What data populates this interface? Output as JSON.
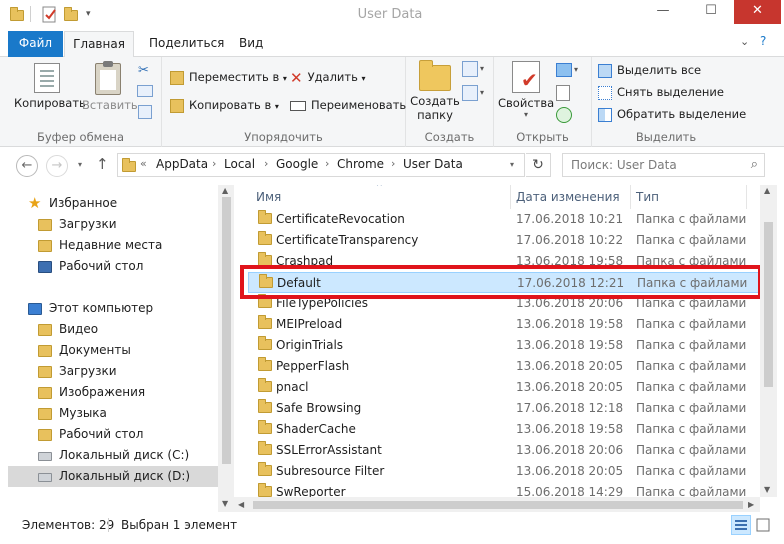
{
  "window": {
    "title": "User Data"
  },
  "ribbon_tabs": [
    "Файл",
    "Главная",
    "Поделиться",
    "Вид"
  ],
  "ribbon": {
    "clipboard": {
      "label": "Буфер обмена",
      "copy": "Копировать",
      "paste": "Вставить"
    },
    "organize": {
      "label": "Упорядочить",
      "move_to": "Переместить в",
      "copy_to": "Копировать в",
      "delete": "Удалить",
      "rename": "Переименовать"
    },
    "create": {
      "label": "Создать",
      "new_folder_line1": "Создать",
      "new_folder_line2": "папку"
    },
    "open": {
      "label": "Открыть",
      "properties": "Свойства"
    },
    "select": {
      "label": "Выделить",
      "select_all": "Выделить все",
      "select_none": "Снять выделение",
      "invert": "Обратить выделение"
    }
  },
  "address": {
    "crumbs": [
      "AppData",
      "Local",
      "Google",
      "Chrome",
      "User Data"
    ],
    "overflow": "«",
    "search_placeholder": "Поиск: User Data"
  },
  "nav": {
    "items": [
      {
        "label": "Избранное",
        "icon": "star-icon",
        "top": true
      },
      {
        "label": "Загрузки",
        "icon": "downloads-folder-icon"
      },
      {
        "label": "Недавние места",
        "icon": "recent-places-icon"
      },
      {
        "label": "Рабочий стол",
        "icon": "desktop-icon"
      },
      {
        "label": "Этот компьютер",
        "icon": "computer-icon",
        "top": true
      },
      {
        "label": "Видео",
        "icon": "videos-folder-icon"
      },
      {
        "label": "Документы",
        "icon": "documents-folder-icon"
      },
      {
        "label": "Загрузки",
        "icon": "downloads-folder-icon"
      },
      {
        "label": "Изображения",
        "icon": "pictures-folder-icon"
      },
      {
        "label": "Музыка",
        "icon": "music-folder-icon"
      },
      {
        "label": "Рабочий стол",
        "icon": "desktop-icon"
      },
      {
        "label": "Локальный диск (C:)",
        "icon": "drive-icon"
      },
      {
        "label": "Локальный диск (D:)",
        "icon": "drive-icon",
        "selected": true
      }
    ]
  },
  "files": {
    "columns": {
      "name": "Имя",
      "date": "Дата изменения",
      "type": "Тип"
    },
    "rows": [
      {
        "name": "CertificateRevocation",
        "date": "17.06.2018 10:21",
        "type": "Папка с файлами"
      },
      {
        "name": "CertificateTransparency",
        "date": "17.06.2018 10:22",
        "type": "Папка с файлами"
      },
      {
        "name": "Crashpad",
        "date": "13.06.2018 19:58",
        "type": "Папка с файлами"
      },
      {
        "name": "Default",
        "date": "17.06.2018 12:21",
        "type": "Папка с файлами",
        "selected": true
      },
      {
        "name": "FileTypePolicies",
        "date": "13.06.2018 20:06",
        "type": "Папка с файлами"
      },
      {
        "name": "MEIPreload",
        "date": "13.06.2018 19:58",
        "type": "Папка с файлами"
      },
      {
        "name": "OriginTrials",
        "date": "13.06.2018 19:58",
        "type": "Папка с файлами"
      },
      {
        "name": "PepperFlash",
        "date": "13.06.2018 20:05",
        "type": "Папка с файлами"
      },
      {
        "name": "pnacl",
        "date": "13.06.2018 20:05",
        "type": "Папка с файлами"
      },
      {
        "name": "Safe Browsing",
        "date": "17.06.2018 12:18",
        "type": "Папка с файлами"
      },
      {
        "name": "ShaderCache",
        "date": "13.06.2018 19:58",
        "type": "Папка с файлами"
      },
      {
        "name": "SSLErrorAssistant",
        "date": "13.06.2018 20:06",
        "type": "Папка с файлами"
      },
      {
        "name": "Subresource Filter",
        "date": "13.06.2018 20:05",
        "type": "Папка с файлами"
      },
      {
        "name": "SwReporter",
        "date": "15.06.2018 14:29",
        "type": "Папка с файлами"
      }
    ]
  },
  "status": {
    "items_count": "Элементов: 29",
    "selected": "Выбран 1 элемент"
  },
  "colors": {
    "accent": "#1979ca",
    "highlight": "#e0141b",
    "selection": "#cce8ff"
  }
}
